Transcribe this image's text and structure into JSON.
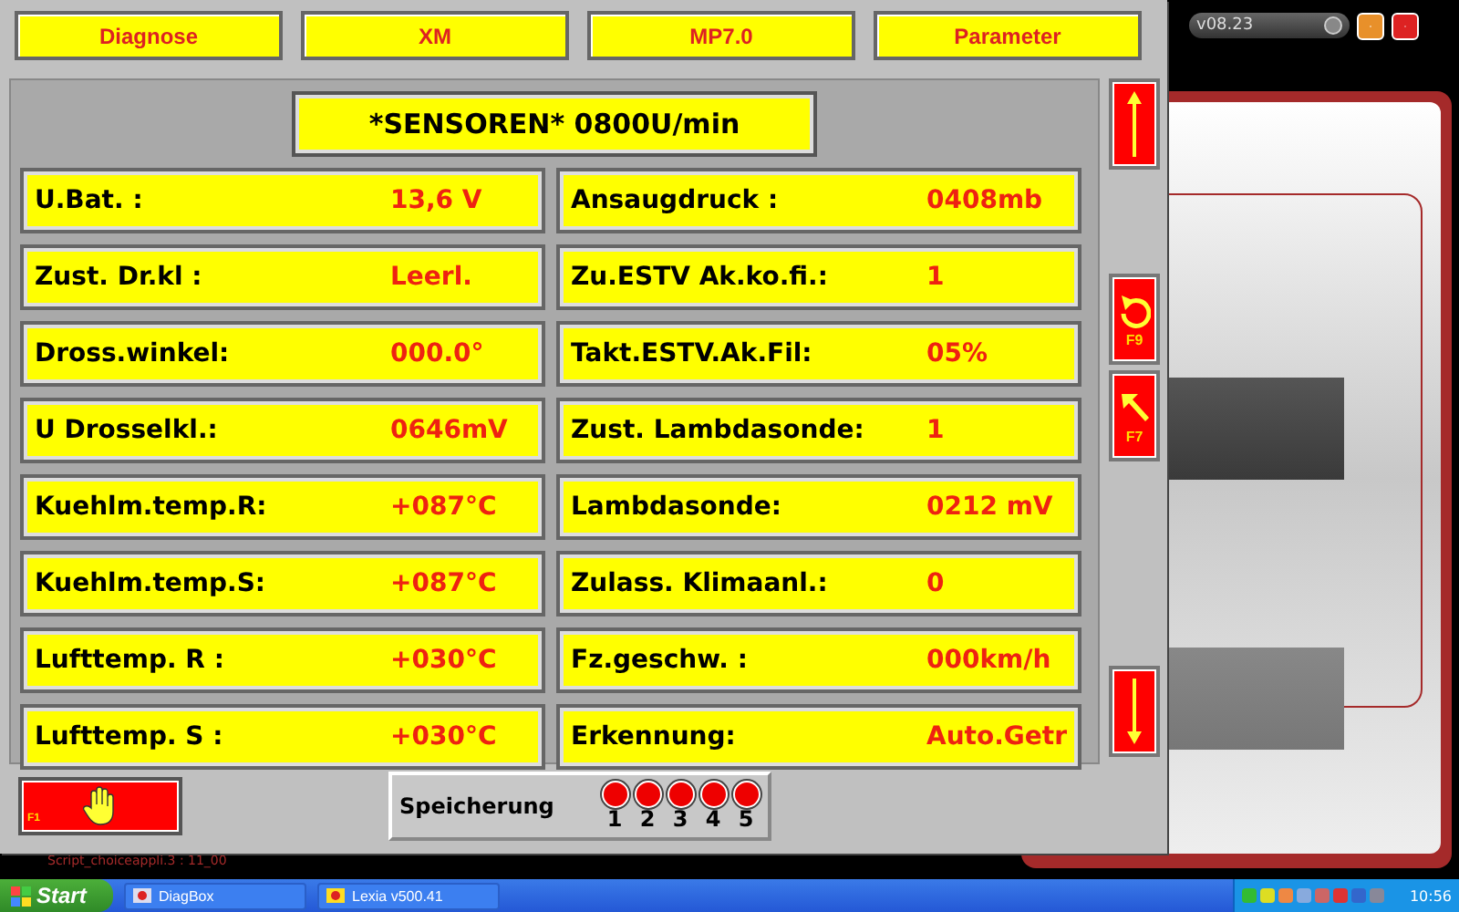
{
  "back_window": {
    "version": "v08.23",
    "status_line": "Script_choiceappli.3 : 11_00"
  },
  "tabs": [
    "Diagnose",
    "XM",
    "MP7.0",
    "Parameter"
  ],
  "header": "*SENSOREN* 0800U/min",
  "sensors": [
    {
      "label": "U.Bat.  :",
      "value": "13,6 V"
    },
    {
      "label": "Ansaugdruck :",
      "value": "0408mb"
    },
    {
      "label": "Zust. Dr.kl :",
      "value": "Leerl."
    },
    {
      "label": "Zu.ESTV Ak.ko.fi.:",
      "value": "1"
    },
    {
      "label": "Dross.winkel:",
      "value": "000.0°"
    },
    {
      "label": "Takt.ESTV.Ak.Fil:",
      "value": "05%"
    },
    {
      "label": "U Drosselkl.:",
      "value": "0646mV"
    },
    {
      "label": "Zust. Lambdasonde:",
      "value": "1"
    },
    {
      "label": "Kuehlm.temp.R:",
      "value": "+087°C"
    },
    {
      "label": "Lambdasonde:",
      "value": "0212 mV"
    },
    {
      "label": "Kuehlm.temp.S:",
      "value": "+087°C"
    },
    {
      "label": "Zulass. Klimaanl.:",
      "value": "0"
    },
    {
      "label": "Lufttemp. R :",
      "value": "+030°C"
    },
    {
      "label": "Fz.geschw. :",
      "value": "000km/h"
    },
    {
      "label": "Lufttemp. S :",
      "value": "+030°C"
    },
    {
      "label": "Erkennung:",
      "value": "Auto.Getr"
    }
  ],
  "side_buttons": [
    {
      "kind": "up"
    },
    {
      "kind": "undo",
      "key": "F9"
    },
    {
      "kind": "back",
      "key": "F7"
    },
    {
      "kind": "down"
    }
  ],
  "stop_button": {
    "key": "F1"
  },
  "memory": {
    "label": "Speicherung",
    "slots": [
      "1",
      "2",
      "3",
      "4",
      "5"
    ]
  },
  "taskbar": {
    "start": "Start",
    "tasks": [
      "DiagBox",
      "Lexia v500.41"
    ],
    "clock": "10:56"
  }
}
